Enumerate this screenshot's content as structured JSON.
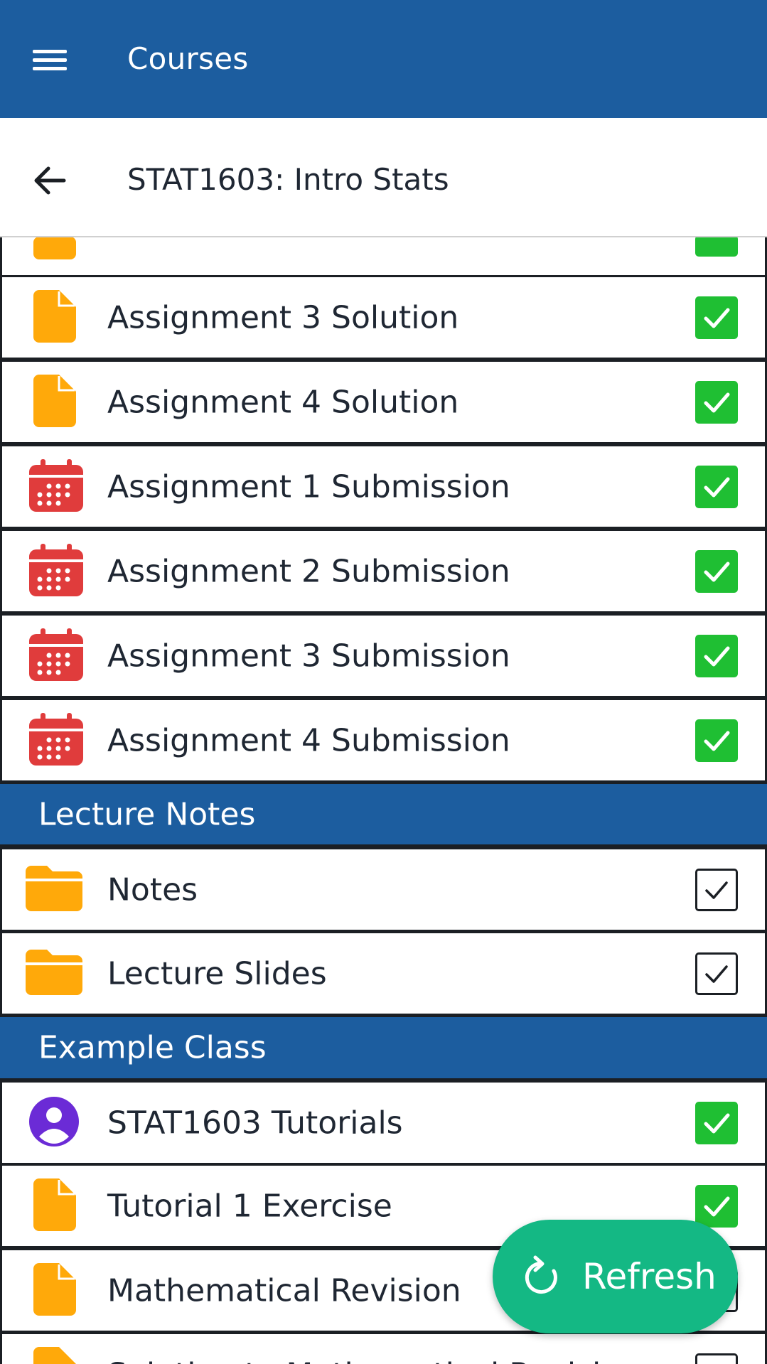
{
  "appbar": {
    "title": "Courses"
  },
  "subbar": {
    "title": "STAT1603: Intro Stats"
  },
  "colors": {
    "primary": "#1c5d9f",
    "done_green": "#1fbf33",
    "file_orange": "#ffa90a",
    "calendar_red": "#e03c3c",
    "avatar_purple": "#6b2bd6",
    "fab_green": "#14b884"
  },
  "rows_top": [
    {
      "label": "Assignment 3 Solution",
      "icon": "file-icon",
      "done": true
    },
    {
      "label": "Assignment 4 Solution",
      "icon": "file-icon",
      "done": true
    },
    {
      "label": "Assignment 1 Submission",
      "icon": "calendar-icon",
      "done": true
    },
    {
      "label": "Assignment 2 Submission",
      "icon": "calendar-icon",
      "done": true
    },
    {
      "label": "Assignment 3 Submission",
      "icon": "calendar-icon",
      "done": true
    },
    {
      "label": "Assignment 4 Submission",
      "icon": "calendar-icon",
      "done": true
    }
  ],
  "sections": [
    {
      "title": "Lecture Notes",
      "items": [
        {
          "label": "Notes",
          "icon": "folder-icon",
          "done": false
        },
        {
          "label": "Lecture Slides",
          "icon": "folder-icon",
          "done": false
        }
      ]
    },
    {
      "title": "Example Class",
      "items": [
        {
          "label": "STAT1603 Tutorials",
          "icon": "person-icon",
          "done": true
        },
        {
          "label": "Tutorial 1 Exercise",
          "icon": "file-icon",
          "done": true
        },
        {
          "label": "Mathematical Revision",
          "icon": "file-icon",
          "done": false
        },
        {
          "label": "Solution to Mathematical Revision",
          "icon": "file-icon",
          "done": false
        }
      ]
    }
  ],
  "fab": {
    "label": "Refresh",
    "icon": "refresh-icon"
  }
}
